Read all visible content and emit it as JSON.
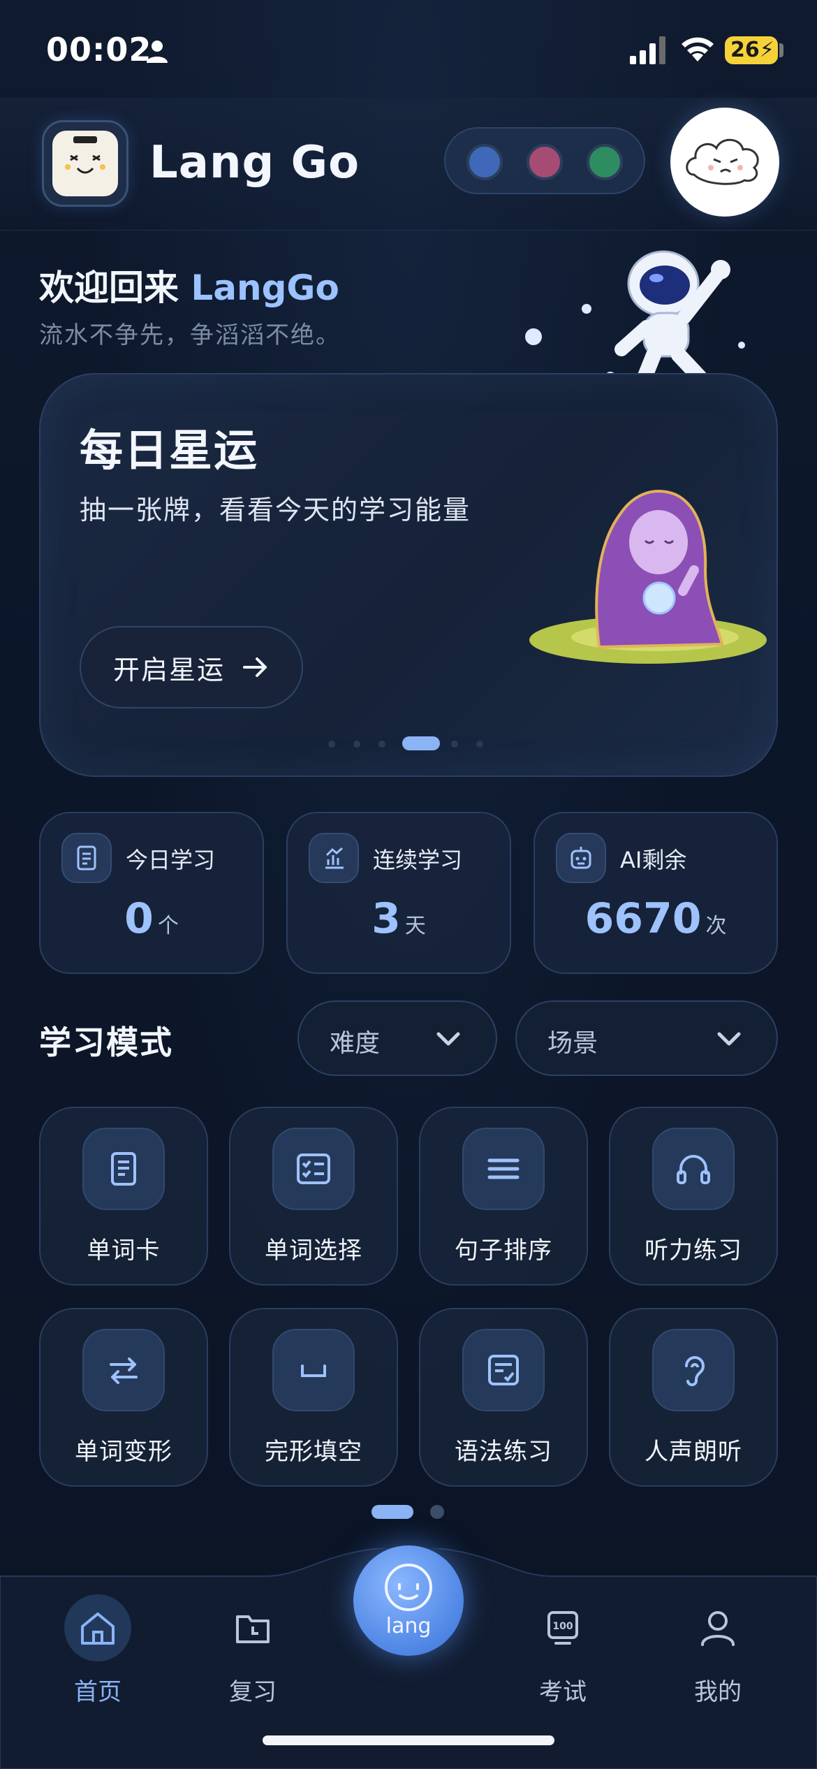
{
  "status_bar": {
    "time": "00:02",
    "battery": "26"
  },
  "header": {
    "title": "Lang Go"
  },
  "welcome": {
    "prefix": "欢迎回来 ",
    "name": "LangGo",
    "subtitle": "流水不争先，争滔滔不绝。"
  },
  "fortune_card": {
    "title": "每日星运",
    "description": "抽一张牌，看看今天的学习能量",
    "button_label": "开启星运"
  },
  "stats": [
    {
      "label": "今日学习",
      "value": "0",
      "unit": "个",
      "icon": "document-icon"
    },
    {
      "label": "连续学习",
      "value": "3",
      "unit": "天",
      "icon": "growth-chart-icon"
    },
    {
      "label": "AI剩余",
      "value": "6670",
      "unit": "次",
      "icon": "robot-icon"
    }
  ],
  "modes": {
    "title": "学习模式",
    "filters": [
      {
        "label": "难度"
      },
      {
        "label": "场景"
      }
    ],
    "items": [
      {
        "label": "单词卡",
        "icon": "book-icon"
      },
      {
        "label": "单词选择",
        "icon": "checklist-icon"
      },
      {
        "label": "句子排序",
        "icon": "lines-icon"
      },
      {
        "label": "听力练习",
        "icon": "headphones-icon"
      },
      {
        "label": "单词变形",
        "icon": "swap-arrows-icon"
      },
      {
        "label": "完形填空",
        "icon": "blank-icon"
      },
      {
        "label": "语法练习",
        "icon": "edit-doc-icon"
      },
      {
        "label": "人声朗听",
        "icon": "ear-icon"
      }
    ]
  },
  "nav": {
    "items": [
      {
        "label": "首页",
        "icon": "home-icon",
        "active": true
      },
      {
        "label": "复习",
        "icon": "folder-clock-icon"
      },
      {
        "label": "考试",
        "icon": "score-100-icon"
      },
      {
        "label": "我的",
        "icon": "user-icon"
      }
    ],
    "center_label": "lang"
  },
  "colors": {
    "accent": "#8bb4f5",
    "background": "#0b1526",
    "card": "#182540"
  }
}
